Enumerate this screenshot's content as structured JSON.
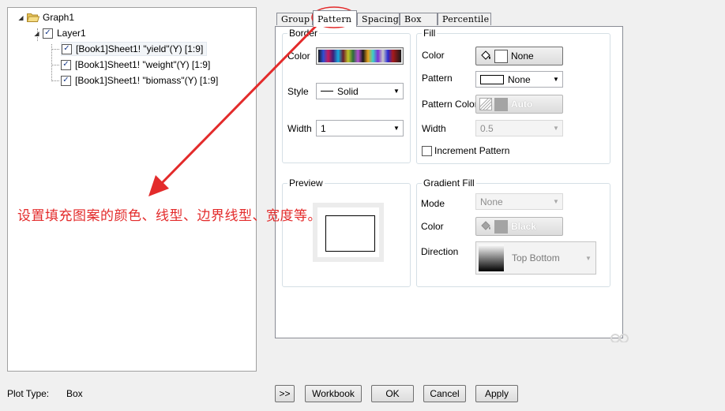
{
  "tree": {
    "root": "Graph1",
    "layer": "Layer1",
    "items": [
      "[Book1]Sheet1! \"yield\"(Y) [1:9]",
      "[Book1]Sheet1! \"weight\"(Y) [1:9]",
      "[Book1]Sheet1! \"biomass\"(Y) [1:9]"
    ]
  },
  "tabs": [
    "Group",
    "Pattern",
    "Spacing",
    "Box",
    "Percentile"
  ],
  "active_tab": "Pattern",
  "border": {
    "title": "Border",
    "color_label": "Color",
    "style_label": "Style",
    "style_value": "Solid",
    "width_label": "Width",
    "width_value": "1"
  },
  "fill": {
    "title": "Fill",
    "color_label": "Color",
    "color_value": "None",
    "pattern_label": "Pattern",
    "pattern_value": "None",
    "pattern_color_label": "Pattern Color",
    "pattern_color_value": "Auto",
    "width_label": "Width",
    "width_value": "0.5",
    "increment_label": "Increment Pattern"
  },
  "preview": {
    "title": "Preview"
  },
  "gradient": {
    "title": "Gradient Fill",
    "mode_label": "Mode",
    "mode_value": "None",
    "color_label": "Color",
    "color_value": "Black",
    "direction_label": "Direction",
    "direction_value": "Top Bottom"
  },
  "annotation": "设置填充图案的颜色、线型、边界线型、宽度等。",
  "plot_type": {
    "label": "Plot Type:",
    "value": "Box"
  },
  "buttons": {
    "expand": ">>",
    "workbook": "Workbook",
    "ok": "OK",
    "cancel": "Cancel",
    "apply": "Apply"
  },
  "colors": {
    "annotation_red": "#e32b2b",
    "panel_border": "#898c95"
  }
}
